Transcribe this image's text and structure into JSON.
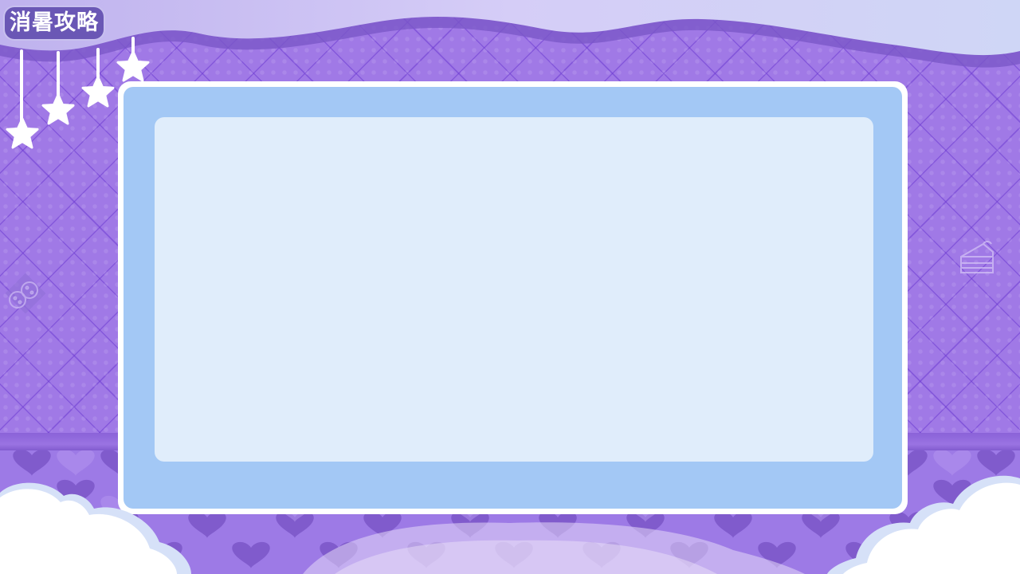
{
  "title": "消暑攻略",
  "colors": {
    "wall": "#a079e6",
    "frame_border": "#ffffff",
    "frame_fill": "#a3c8f5",
    "panel_fill": "#e0edfb",
    "title_tag": "#6a57b5"
  },
  "decorations": {
    "left_icon": "cookies-icon",
    "right_icon": "cake-slice-icon",
    "hanging_stars": 4
  }
}
